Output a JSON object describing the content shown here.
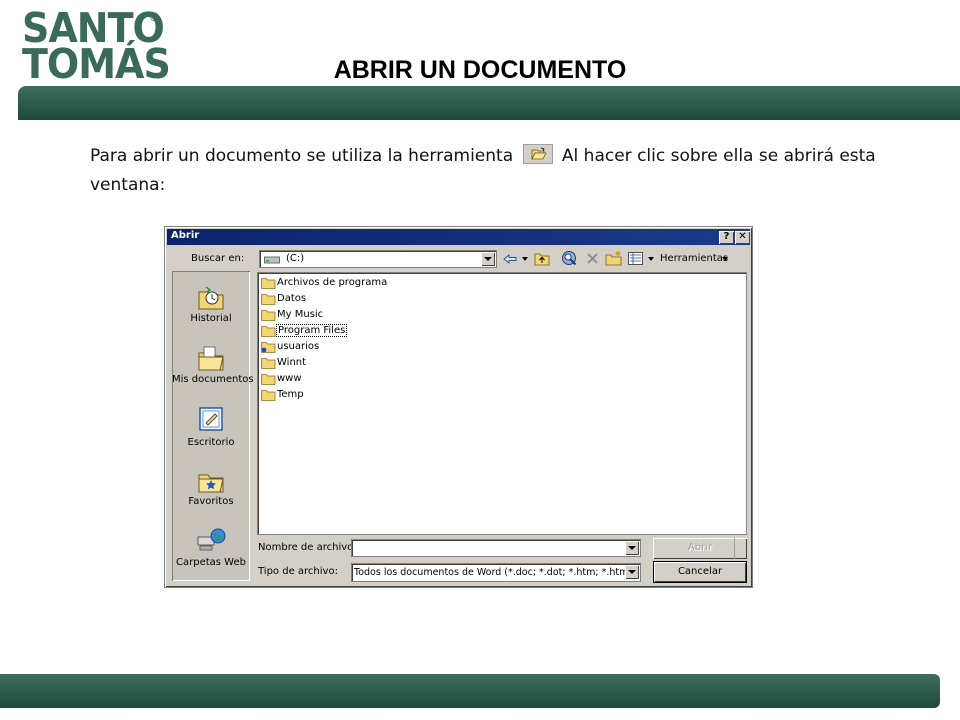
{
  "slide": {
    "logo_line1": "SANTO",
    "logo_line2": "TOMÁS",
    "logo_mark": "®",
    "title": "ABRIR UN DOCUMENTO",
    "intro_before": "Para abrir un documento se utiliza la herramienta",
    "intro_after": "Al hacer clic sobre ella se abrirá esta ventana:",
    "tool_icon": "open-folder-icon"
  },
  "colors": {
    "brand_green": "#2d5c4a",
    "titlebar_blue": "#0a246a",
    "dialog_gray": "#d4d0c8"
  },
  "dialog": {
    "title": "Abrir",
    "help_btn": "?",
    "close_btn": "✕",
    "look_in_label": "Buscar en:",
    "look_in_value": "(C:)",
    "tools_label": "Herramientas",
    "sidebar": [
      {
        "label": "Historial",
        "icon": "history-folder-icon"
      },
      {
        "label": "Mis documentos",
        "icon": "my-documents-icon"
      },
      {
        "label": "Escritorio",
        "icon": "desktop-icon"
      },
      {
        "label": "Favoritos",
        "icon": "favorites-icon"
      },
      {
        "label": "Carpetas Web",
        "icon": "web-folders-icon"
      }
    ],
    "files": [
      "Archivos de programa",
      "Datos",
      "My Music",
      "Program Files",
      "usuarios",
      "Winnt",
      "www",
      "Temp"
    ],
    "filename_label": "Nombre de archivo:",
    "filename_value": "",
    "filetype_label": "Tipo de archivo:",
    "filetype_value": "Todos los documentos de Word (*.doc; *.dot; *.htm; *.htm",
    "open_btn": "Abrir",
    "cancel_btn": "Cancelar"
  }
}
